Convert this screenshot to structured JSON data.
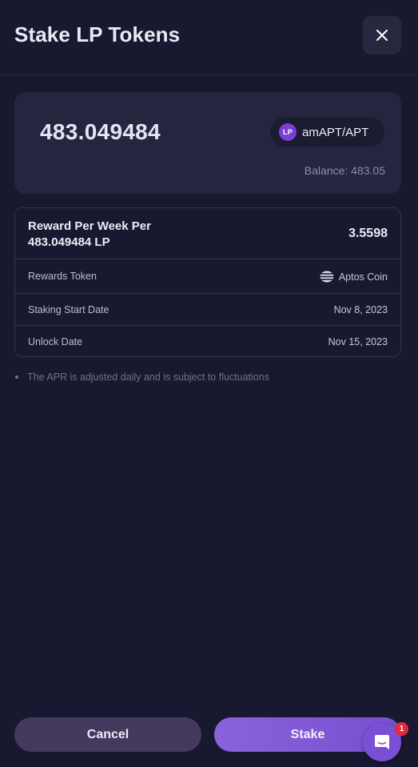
{
  "modal": {
    "title": "Stake LP Tokens"
  },
  "amount_card": {
    "amount": "483.049484",
    "token_badge": "LP",
    "token_name": "amAPT/APT",
    "balance": "Balance: 483.05"
  },
  "details": {
    "reward_label_line1": "Reward Per Week Per",
    "reward_label_line2": "483.049484 LP",
    "reward_value": "3.5598",
    "rows": [
      {
        "label": "Rewards Token",
        "value": "Aptos Coin",
        "icon": "aptos-coin-icon"
      },
      {
        "label": "Staking Start Date",
        "value": "Nov 8, 2023"
      },
      {
        "label": "Unlock Date",
        "value": "Nov 15, 2023"
      }
    ]
  },
  "note": "The APR is adjusted daily and is subject to fluctuations",
  "actions": {
    "cancel_label": "Cancel",
    "stake_label": "Stake"
  },
  "chat": {
    "badge_count": "1",
    "icon": "chat-icon"
  },
  "colors": {
    "background": "#181830",
    "card": "#252540",
    "accent": "#7b4fd4",
    "lp_badge": "#7a3fd2",
    "cancel": "#433a5e",
    "notification": "#e5283c"
  }
}
